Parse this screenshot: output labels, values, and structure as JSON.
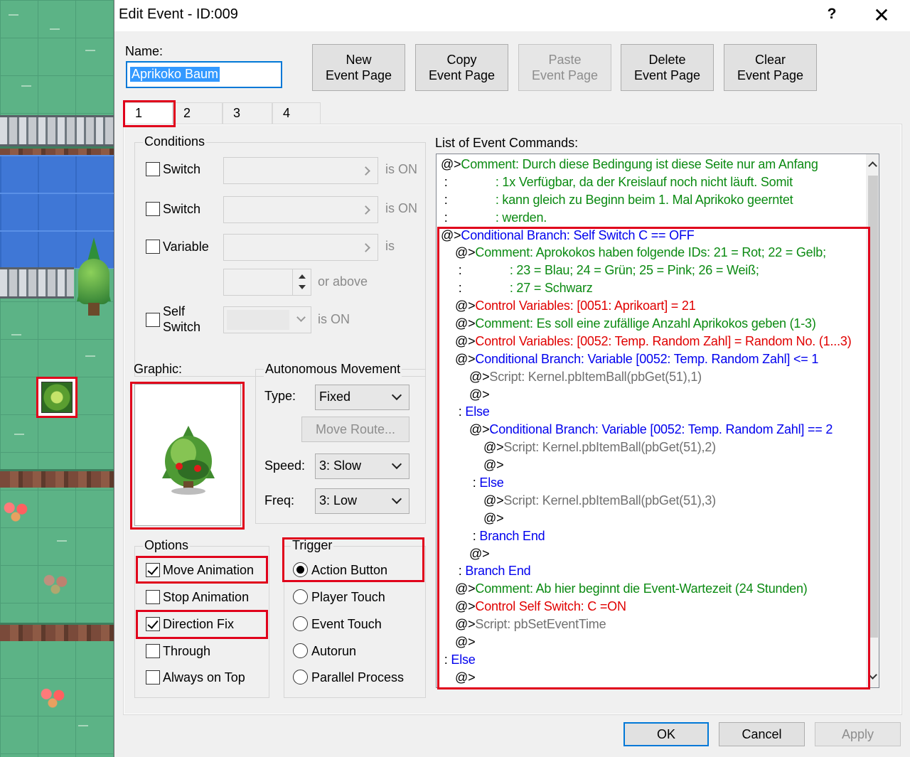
{
  "dialog": {
    "title": "Edit Event - ID:009",
    "help": "?",
    "close": "✕"
  },
  "name": {
    "label": "Name:",
    "value": "Aprikoko Baum"
  },
  "page_buttons": {
    "new": [
      "New",
      "Event Page"
    ],
    "copy": [
      "Copy",
      "Event Page"
    ],
    "paste": [
      "Paste",
      "Event Page"
    ],
    "delete": [
      "Delete",
      "Event Page"
    ],
    "clear": [
      "Clear",
      "Event Page"
    ]
  },
  "tabs": [
    "1",
    "2",
    "3",
    "4"
  ],
  "conditions": {
    "title": "Conditions",
    "switch1": {
      "label": "Switch",
      "suffix": "is ON"
    },
    "switch2": {
      "label": "Switch",
      "suffix": "is ON"
    },
    "variable": {
      "label": "Variable",
      "suffix": "is"
    },
    "or_above": "or above",
    "self_switch": {
      "label1": "Self",
      "label2": "Switch",
      "suffix": "is ON"
    }
  },
  "graphic": {
    "label": "Graphic:"
  },
  "movement": {
    "title": "Autonomous Movement",
    "type_label": "Type:",
    "type_value": "Fixed",
    "move_route": "Move Route...",
    "speed_label": "Speed:",
    "speed_value": "3: Slow",
    "freq_label": "Freq:",
    "freq_value": "3: Low"
  },
  "options": {
    "title": "Options",
    "items": [
      {
        "label": "Move Animation",
        "checked": true
      },
      {
        "label": "Stop Animation",
        "checked": false
      },
      {
        "label": "Direction Fix",
        "checked": true
      },
      {
        "label": "Through",
        "checked": false
      },
      {
        "label": "Always on Top",
        "checked": false
      }
    ]
  },
  "trigger": {
    "title": "Trigger",
    "items": [
      {
        "label": "Action Button",
        "selected": true
      },
      {
        "label": "Player Touch",
        "selected": false
      },
      {
        "label": "Event Touch",
        "selected": false
      },
      {
        "label": "Autorun",
        "selected": false
      },
      {
        "label": "Parallel Process",
        "selected": false
      }
    ]
  },
  "commands": {
    "label": "List of Event Commands:",
    "lines": [
      {
        "indent": 0,
        "parts": [
          [
            "@>",
            "k"
          ],
          [
            "Comment: Durch diese Bedingung ist diese Seite nur am Anfang",
            "green"
          ]
        ]
      },
      {
        "indent": 0,
        "parts": [
          [
            " :              ",
            "k"
          ],
          [
            ": 1x Verfügbar, da der Kreislauf noch nicht läuft. Somit",
            "green"
          ]
        ]
      },
      {
        "indent": 0,
        "parts": [
          [
            " :              ",
            "k"
          ],
          [
            ": kann gleich zu Beginn beim 1. Mal Aprikoko geerntet",
            "green"
          ]
        ]
      },
      {
        "indent": 0,
        "parts": [
          [
            " :              ",
            "k"
          ],
          [
            ": werden.",
            "green"
          ]
        ]
      },
      {
        "indent": 0,
        "parts": [
          [
            "@>",
            "k"
          ],
          [
            "Conditional Branch: Self Switch C == OFF",
            "blue"
          ]
        ]
      },
      {
        "indent": 1,
        "parts": [
          [
            "@>",
            "k"
          ],
          [
            "Comment: Aprokokos haben folgende IDs: 21 = Rot; 22 = Gelb;",
            "green"
          ]
        ]
      },
      {
        "indent": 1,
        "parts": [
          [
            " :              ",
            "k"
          ],
          [
            ": 23 = Blau; 24 = Grün; 25 = Pink; 26 = Weiß;",
            "green"
          ]
        ]
      },
      {
        "indent": 1,
        "parts": [
          [
            " :              ",
            "k"
          ],
          [
            ": 27 = Schwarz",
            "green"
          ]
        ]
      },
      {
        "indent": 1,
        "parts": [
          [
            "@>",
            "k"
          ],
          [
            "Control Variables: [0051: Aprikoart] = 21",
            "red"
          ]
        ]
      },
      {
        "indent": 1,
        "parts": [
          [
            "@>",
            "k"
          ],
          [
            "Comment: Es soll eine zufällige Anzahl Aprikokos geben (1-3)",
            "green"
          ]
        ]
      },
      {
        "indent": 1,
        "parts": [
          [
            "@>",
            "k"
          ],
          [
            "Control Variables: [0052: Temp. Random Zahl] = Random No. (1...3)",
            "red"
          ]
        ]
      },
      {
        "indent": 1,
        "parts": [
          [
            "@>",
            "k"
          ],
          [
            "Conditional Branch: Variable [0052: Temp. Random Zahl] <= 1",
            "blue"
          ]
        ]
      },
      {
        "indent": 2,
        "parts": [
          [
            "@>",
            "k"
          ],
          [
            "Script: Kernel.pbItemBall(pbGet(51),1)",
            "gray"
          ]
        ]
      },
      {
        "indent": 2,
        "parts": [
          [
            "@>",
            "k"
          ]
        ]
      },
      {
        "indent": 1,
        "parts": [
          [
            " : ",
            "k"
          ],
          [
            "Else",
            "blue"
          ]
        ]
      },
      {
        "indent": 2,
        "parts": [
          [
            "@>",
            "k"
          ],
          [
            "Conditional Branch: Variable [0052: Temp. Random Zahl] == 2",
            "blue"
          ]
        ]
      },
      {
        "indent": 3,
        "parts": [
          [
            "@>",
            "k"
          ],
          [
            "Script: Kernel.pbItemBall(pbGet(51),2)",
            "gray"
          ]
        ]
      },
      {
        "indent": 3,
        "parts": [
          [
            "@>",
            "k"
          ]
        ]
      },
      {
        "indent": 2,
        "parts": [
          [
            " : ",
            "k"
          ],
          [
            "Else",
            "blue"
          ]
        ]
      },
      {
        "indent": 3,
        "parts": [
          [
            "@>",
            "k"
          ],
          [
            "Script: Kernel.pbItemBall(pbGet(51),3)",
            "gray"
          ]
        ]
      },
      {
        "indent": 3,
        "parts": [
          [
            "@>",
            "k"
          ]
        ]
      },
      {
        "indent": 2,
        "parts": [
          [
            " : ",
            "k"
          ],
          [
            "Branch End",
            "blue"
          ]
        ]
      },
      {
        "indent": 2,
        "parts": [
          [
            "@>",
            "k"
          ]
        ]
      },
      {
        "indent": 1,
        "parts": [
          [
            " : ",
            "k"
          ],
          [
            "Branch End",
            "blue"
          ]
        ]
      },
      {
        "indent": 1,
        "parts": [
          [
            "@>",
            "k"
          ],
          [
            "Comment: Ab hier beginnt die Event-Wartezeit (24 Stunden)",
            "green"
          ]
        ]
      },
      {
        "indent": 1,
        "parts": [
          [
            "@>",
            "k"
          ],
          [
            "Control Self Switch: C =ON",
            "red"
          ]
        ]
      },
      {
        "indent": 1,
        "parts": [
          [
            "@>",
            "k"
          ],
          [
            "Script: pbSetEventTime",
            "gray"
          ]
        ]
      },
      {
        "indent": 1,
        "parts": [
          [
            "@>",
            "k"
          ]
        ]
      },
      {
        "indent": 0,
        "parts": [
          [
            " : ",
            "k"
          ],
          [
            "Else",
            "blue"
          ]
        ]
      },
      {
        "indent": 1,
        "parts": [
          [
            "@>",
            "k"
          ]
        ]
      }
    ]
  },
  "footer": {
    "ok": "OK",
    "cancel": "Cancel",
    "apply": "Apply"
  },
  "colors": {
    "highlight": "#e0001b",
    "selection": "#3399ff",
    "comment": "#0b8a12",
    "control": "#e00000",
    "branch": "#0000ee"
  },
  "icons": {
    "help": "question-icon",
    "close": "close-icon",
    "tree": "tree-sprite-icon"
  }
}
